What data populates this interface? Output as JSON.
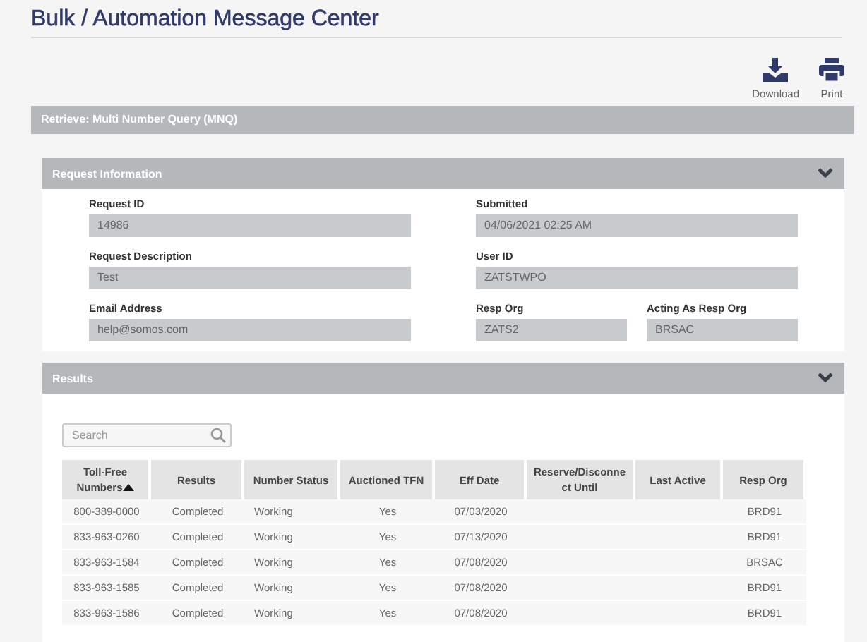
{
  "page": {
    "title": "Bulk / Automation Message Center"
  },
  "actions": [
    {
      "kind": "download",
      "label": "Download"
    },
    {
      "kind": "print",
      "label": "Print"
    }
  ],
  "retrieve_bar": {
    "title": "Retrieve: Multi Number Query (MNQ)"
  },
  "request_info": {
    "title": "Request Information",
    "expanded": true,
    "rows": [
      {
        "left": {
          "label": "Request ID",
          "value": "14986"
        },
        "right": [
          {
            "label": "Submitted",
            "value": "04/06/2021 02:25 AM"
          }
        ]
      },
      {
        "left": {
          "label": "Request Description",
          "value": "Test"
        },
        "right": [
          {
            "label": "User ID",
            "value": "ZATSTWPO"
          }
        ]
      },
      {
        "left": {
          "label": "Email Address",
          "value": "help@somos.com"
        },
        "right": [
          {
            "label": "Resp Org",
            "value": "ZATS2"
          },
          {
            "label": "Acting As Resp Org",
            "value": "BRSAC"
          }
        ]
      }
    ]
  },
  "results": {
    "title": "Results",
    "expanded": true,
    "search": {
      "placeholder": "Search"
    },
    "columns": [
      {
        "label": "Toll-Free Numbers",
        "sorted": true
      },
      {
        "label": "Results",
        "sorted": false
      },
      {
        "label": "Number Status",
        "sorted": false
      },
      {
        "label": "Auctioned TFN",
        "sorted": false
      },
      {
        "label": "Eff Date",
        "sorted": false
      },
      {
        "label": "Reserve/Disconnect Until",
        "sorted": false
      },
      {
        "label": "Last Active",
        "sorted": false
      },
      {
        "label": "Resp Org",
        "sorted": false
      }
    ],
    "rows": [
      [
        "800-389-0000",
        "Completed",
        "Working",
        "Yes",
        "07/03/2020",
        "",
        "",
        "BRD91"
      ],
      [
        "833-963-0260",
        "Completed",
        "Working",
        "Yes",
        "07/13/2020",
        "",
        "",
        "BRD91"
      ],
      [
        "833-963-1584",
        "Completed",
        "Working",
        "Yes",
        "07/08/2020",
        "",
        "",
        "BRSAC"
      ],
      [
        "833-963-1585",
        "Completed",
        "Working",
        "Yes",
        "07/08/2020",
        "",
        "",
        "BRD91"
      ],
      [
        "833-963-1586",
        "Completed",
        "Working",
        "Yes",
        "07/08/2020",
        "",
        "",
        "BRD91"
      ]
    ]
  }
}
